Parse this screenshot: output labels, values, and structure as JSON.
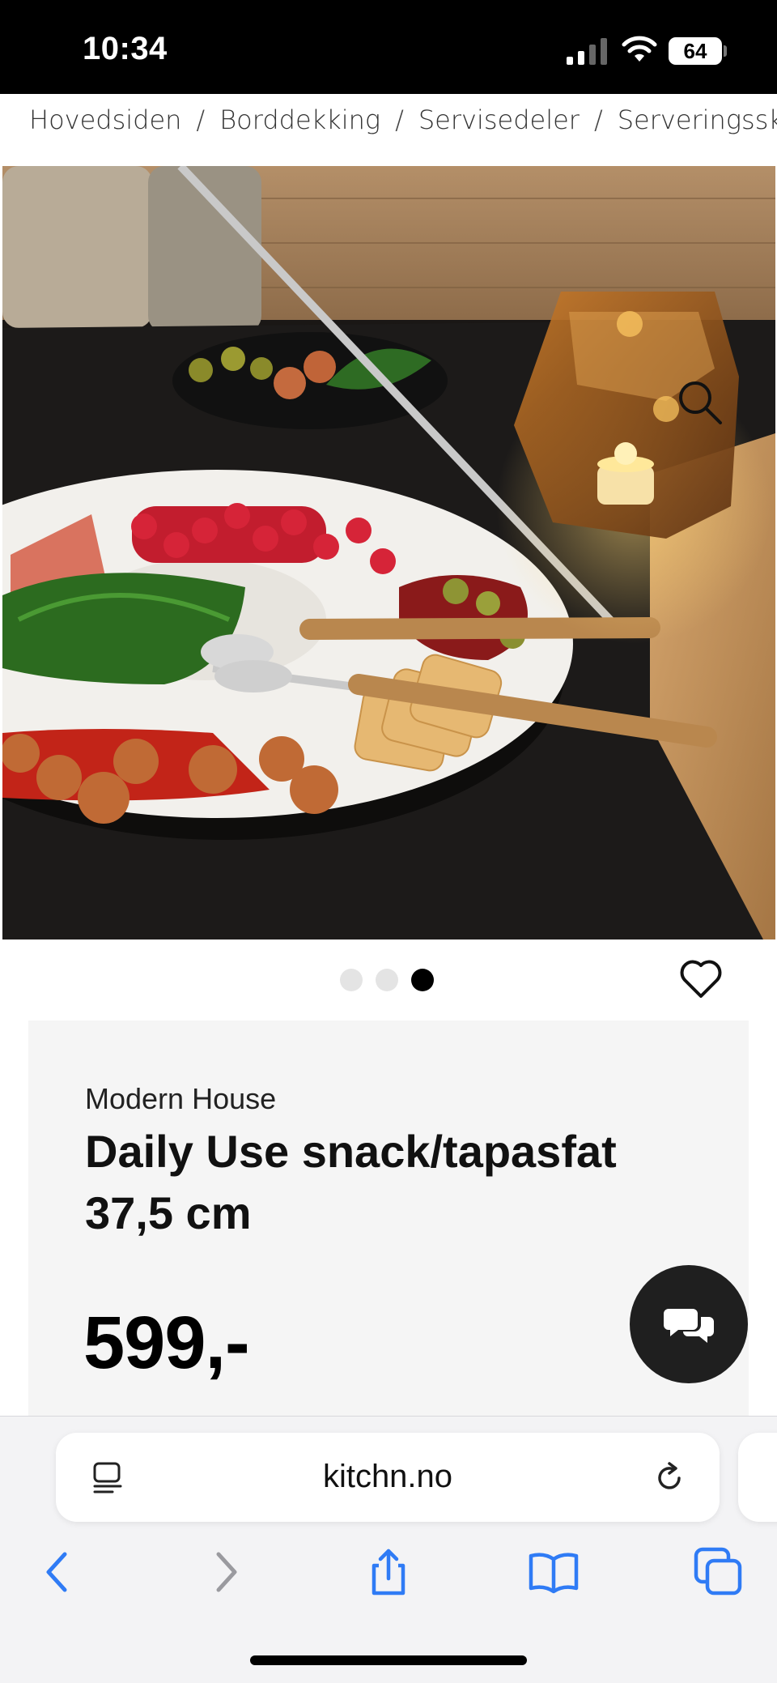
{
  "status_bar": {
    "time": "10:34",
    "battery": "64"
  },
  "breadcrumb": [
    "Hovedsiden",
    "Borddekking",
    "Servisedeler",
    "Serveringsskå"
  ],
  "breadcrumb_separator": "/",
  "gallery": {
    "image_count": 3,
    "active_index": 2
  },
  "product": {
    "brand": "Modern House",
    "title": "Daily Use snack/tapasfat 37,5 cm",
    "price": "599,-"
  },
  "browser": {
    "url": "kitchn.no"
  },
  "icons": {
    "zoom": "search-icon",
    "wishlist": "heart-icon",
    "chat": "chat-bubbles-icon",
    "reader": "reader-mode-icon",
    "reload": "reload-icon",
    "back": "chevron-left-icon",
    "forward": "chevron-right-icon",
    "share": "share-icon",
    "bookmarks": "book-icon",
    "tabs": "tabs-icon"
  },
  "colors": {
    "accent": "#2f7bf5",
    "chat_button": "#1f1f1f",
    "card_bg": "#f5f5f5"
  }
}
